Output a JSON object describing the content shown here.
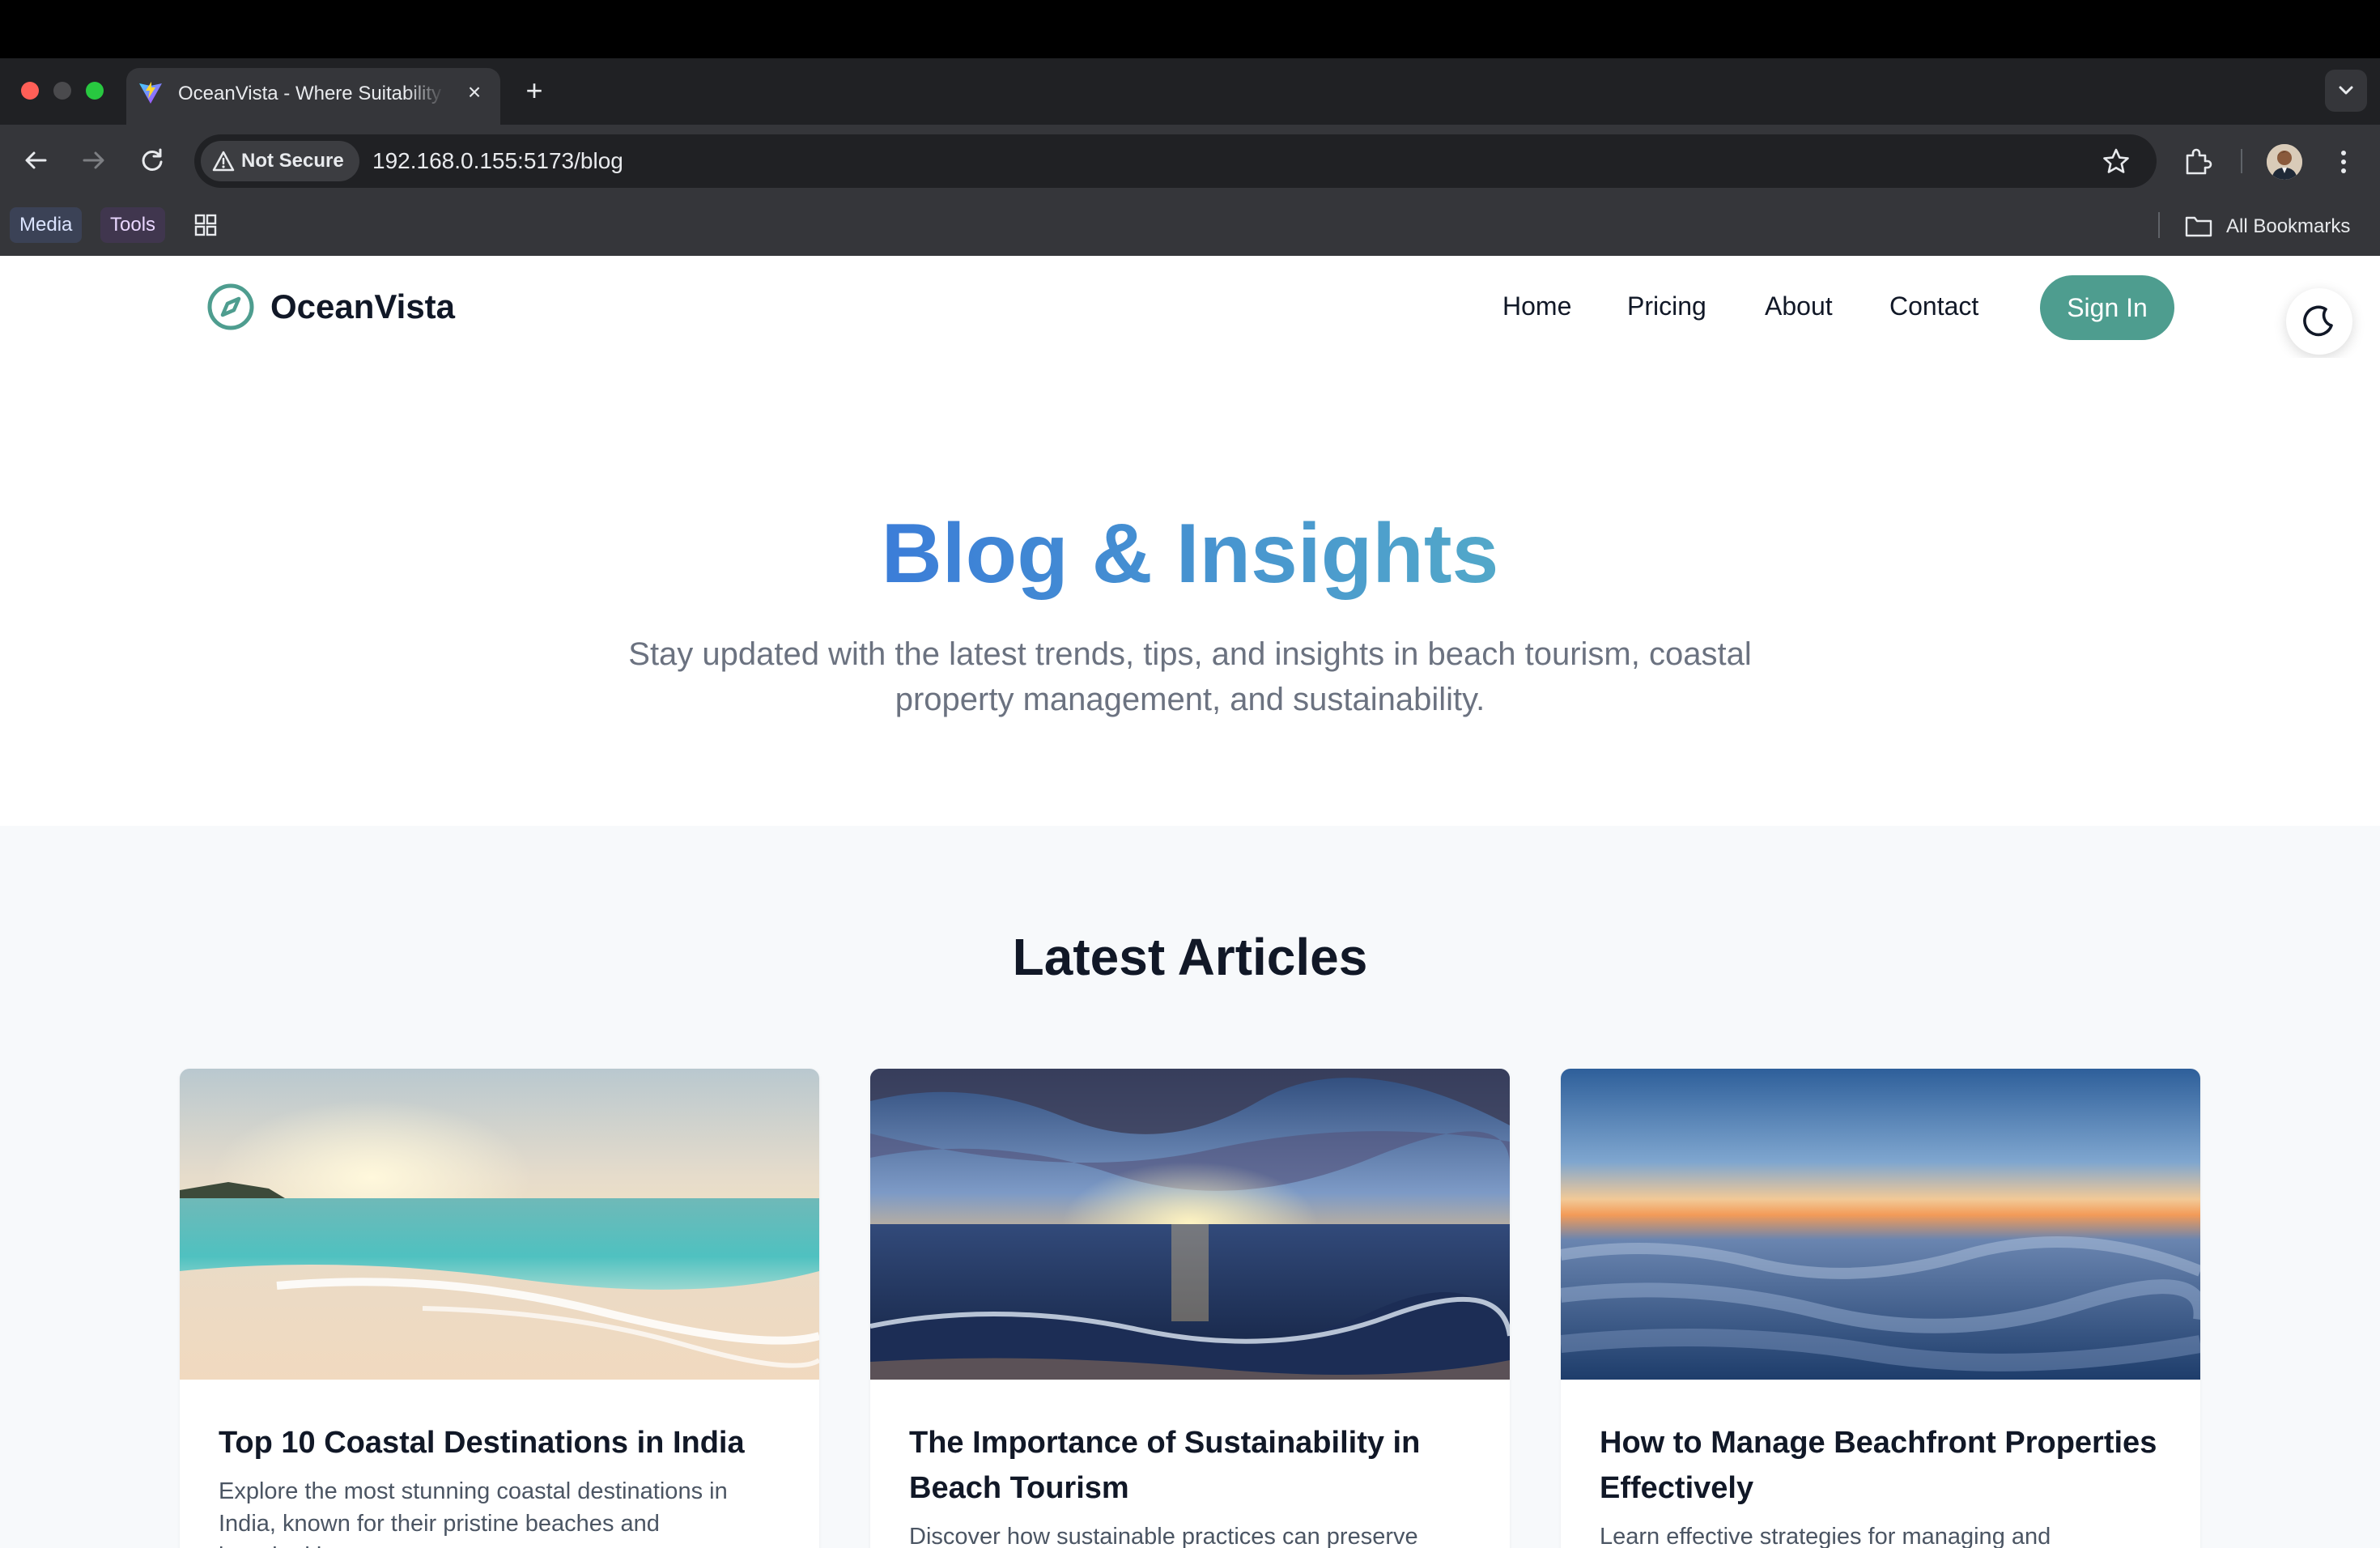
{
  "browser": {
    "tab_title": "OceanVista - Where Suitability Meets",
    "tab_close_icon": "close-icon",
    "new_tab_icon": "plus-icon",
    "security_label": "Not Secure",
    "url": "192.168.0.155:5173/blog",
    "bookmarks": [
      {
        "label": "Media"
      },
      {
        "label": "Tools"
      }
    ],
    "all_bookmarks_label": "All Bookmarks"
  },
  "site": {
    "brand": "OceanVista",
    "nav": [
      {
        "label": "Home"
      },
      {
        "label": "Pricing"
      },
      {
        "label": "About"
      },
      {
        "label": "Contact"
      }
    ],
    "sign_in_label": "Sign In",
    "accent_color": "#4e9d8f"
  },
  "hero": {
    "title": "Blog & Insights",
    "subtitle": "Stay updated with the latest trends, tips, and insights in beach tourism, coastal property management, and sustainability.",
    "gradient": [
      "#3b7dd8",
      "#52a8c9"
    ]
  },
  "articles": {
    "heading": "Latest Articles",
    "items": [
      {
        "title": "Top 10 Coastal Destinations in India",
        "excerpt": "Explore the most stunning coastal destinations in India, known for their pristine beaches and breathtaking sunsets."
      },
      {
        "title": "The Importance of Sustainability in Beach Tourism",
        "excerpt": "Discover how sustainable practices can preserve"
      },
      {
        "title": "How to Manage Beachfront Properties Effectively",
        "excerpt": "Learn effective strategies for managing and"
      }
    ]
  }
}
